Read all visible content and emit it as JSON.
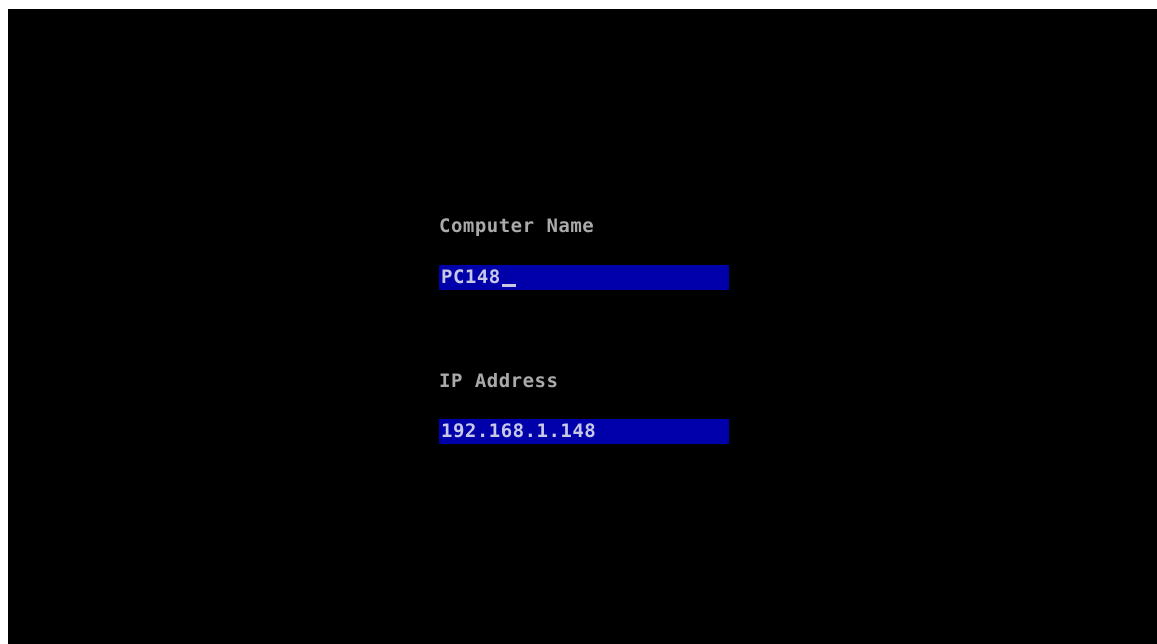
{
  "form": {
    "computer_name": {
      "label": "Computer Name",
      "value": "PC148"
    },
    "ip_address": {
      "label": "IP Address",
      "value": "192.168.1.148"
    }
  },
  "colors": {
    "background": "#000000",
    "label_text": "#aaaaaa",
    "field_background": "#0000aa",
    "field_text": "#c8c8e6"
  }
}
